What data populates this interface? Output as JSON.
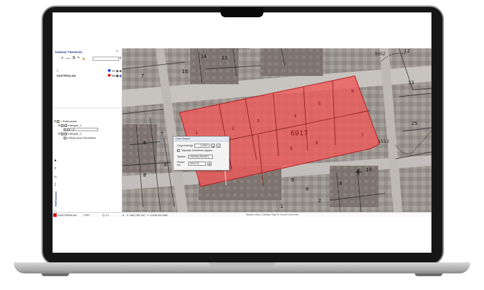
{
  "panel": {
    "title": "Katman Yöneticisi",
    "close": "×",
    "toolbar": [
      "+",
      "—",
      "⧉",
      "✎",
      "🔒"
    ],
    "filter": "⊽",
    "layers": [
      {
        "name": "≡",
        "pct": "%0"
      },
      {
        "name": "DASTERALAN",
        "pct": "%0"
      }
    ]
  },
  "tree": {
    "root": "Referanslar",
    "cat1": "Kategori_1",
    "cat1_input": "ilf",
    "cat2": "Kategori_2",
    "cat2_item": "Bing Uydu Görüntüsü"
  },
  "rail": {
    "icons": [
      "●",
      "⌕",
      "∿",
      "⟟",
      "⚐"
    ],
    "vertical_label": "Referanslar"
  },
  "map": {
    "parcels": [
      "1",
      "2",
      "3",
      "4",
      "5",
      "6",
      "7",
      "8",
      "9",
      "10",
      "12"
    ],
    "big_label": "6917",
    "labels": [
      "14",
      "13",
      "15",
      "7",
      "12",
      "13",
      "25",
      "5552",
      "5553",
      "6",
      "7",
      "8",
      "8",
      "9",
      "10",
      "3",
      "1",
      "2",
      "8",
      "9"
    ]
  },
  "dialog": {
    "title": "Cizim Kaydet",
    "scale_label": "Çizgi Kalınlığı",
    "scale_value": "1.0000",
    "checkbox_label": "Topolojik Düzeltme Uygula",
    "layer_label": "Tabaka",
    "layer_value": "PARSELPARSEL",
    "parcel_label": "Parsel No",
    "parcel_value": "6917/13"
  },
  "status": {
    "layer": "DASTERALAN",
    "crs": "ITRF",
    "scale": "Q 1:1",
    "coords": "X: 484,755.187, Y: 4,409,204.989",
    "hint": "Başlatır Alanı Çizildiye Bağ İle Yazılım Düzenler"
  },
  "colors": {
    "parcel_fill": "#ef5a5a",
    "parcel_stroke": "#b71c1c",
    "accent": "#1d3f8a"
  }
}
